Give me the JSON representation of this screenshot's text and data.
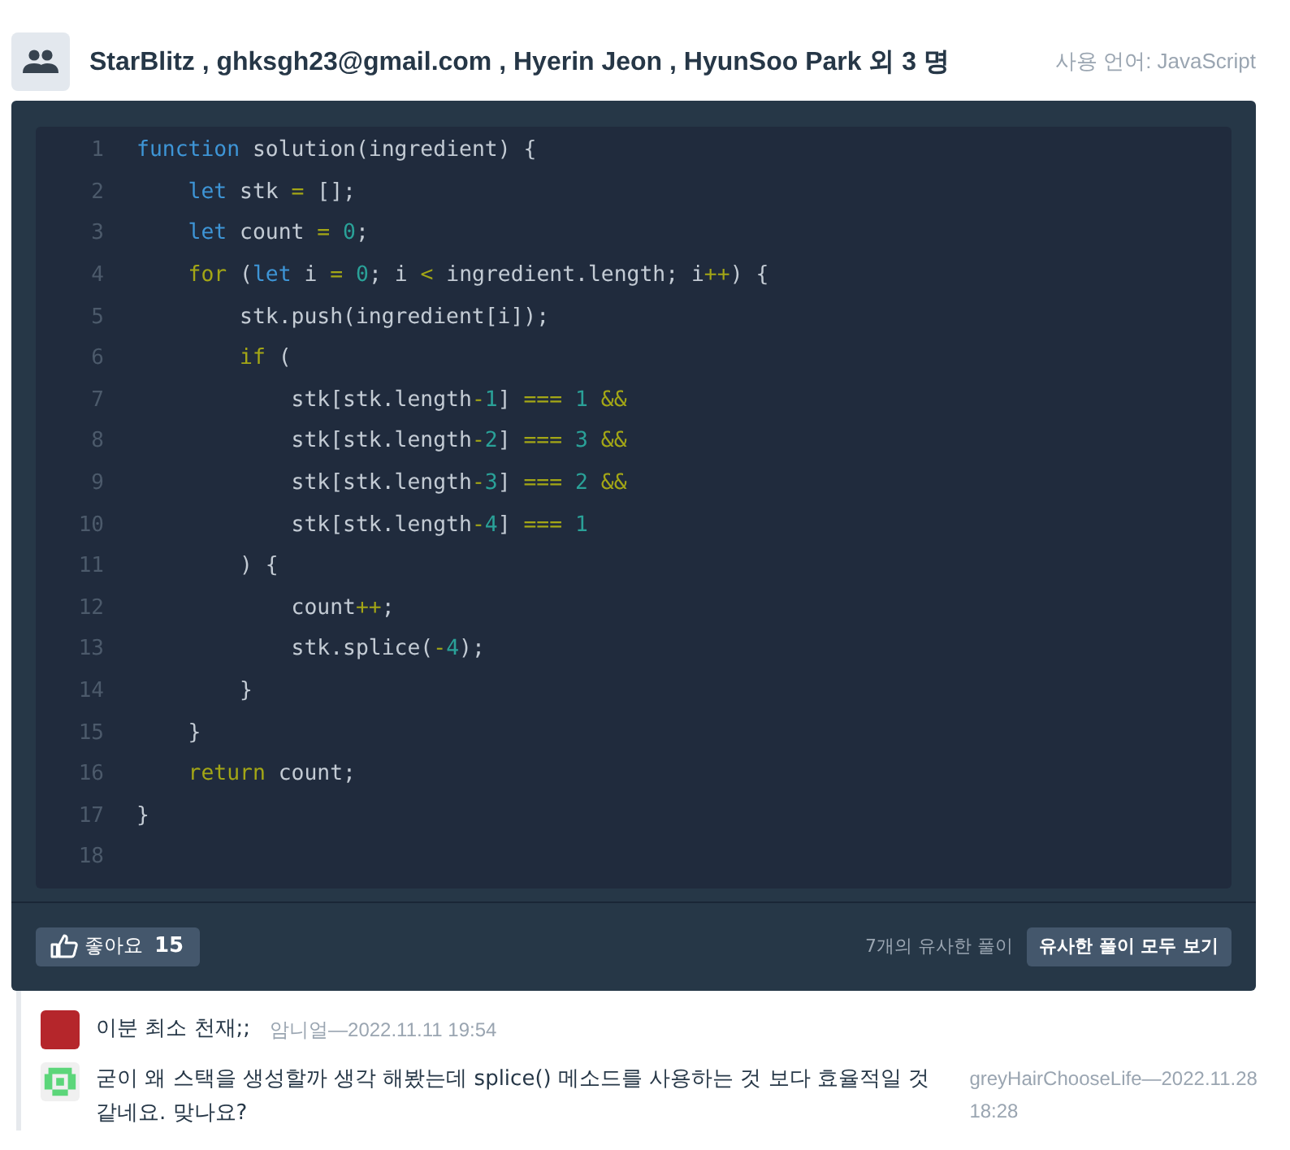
{
  "header": {
    "authors": "StarBlitz , ghksgh23@gmail.com , Hyerin Jeon , HyunSoo Park 외 3 명",
    "language": "사용 언어: JavaScript"
  },
  "code": {
    "lines": [
      {
        "number": "1",
        "tokens": [
          {
            "t": "function",
            "color": "#3e95d6"
          },
          {
            "t": " solution(ingredient) {",
            "color": "#c3cbd4"
          }
        ]
      },
      {
        "number": "2",
        "tokens": [
          {
            "t": "    let",
            "color": "#3e95d6"
          },
          {
            "t": " stk ",
            "color": "#c3cbd4"
          },
          {
            "t": "=",
            "color": "#a3a616"
          },
          {
            "t": " [];",
            "color": "#c3cbd4"
          }
        ]
      },
      {
        "number": "3",
        "tokens": [
          {
            "t": "    let",
            "color": "#3e95d6"
          },
          {
            "t": " count ",
            "color": "#c3cbd4"
          },
          {
            "t": "=",
            "color": "#a3a616"
          },
          {
            "t": " 0",
            "color": "#2aa198"
          },
          {
            "t": ";",
            "color": "#c3cbd4"
          }
        ]
      },
      {
        "number": "4",
        "tokens": [
          {
            "t": "    for",
            "color": "#a3a616"
          },
          {
            "t": " (",
            "color": "#c3cbd4"
          },
          {
            "t": "let",
            "color": "#3e95d6"
          },
          {
            "t": " i ",
            "color": "#c3cbd4"
          },
          {
            "t": "=",
            "color": "#a3a616"
          },
          {
            "t": " 0",
            "color": "#2aa198"
          },
          {
            "t": "; i ",
            "color": "#c3cbd4"
          },
          {
            "t": "<",
            "color": "#a3a616"
          },
          {
            "t": " ingredient.length; i",
            "color": "#c3cbd4"
          },
          {
            "t": "++",
            "color": "#a3a616"
          },
          {
            "t": ") {",
            "color": "#c3cbd4"
          }
        ]
      },
      {
        "number": "5",
        "tokens": [
          {
            "t": "        stk.push(ingredient[i]);",
            "color": "#c3cbd4"
          }
        ]
      },
      {
        "number": "6",
        "tokens": [
          {
            "t": "        if",
            "color": "#a3a616"
          },
          {
            "t": " (",
            "color": "#c3cbd4"
          }
        ]
      },
      {
        "number": "7",
        "tokens": [
          {
            "t": "            stk[stk.length",
            "color": "#c3cbd4"
          },
          {
            "t": "-",
            "color": "#a3a616"
          },
          {
            "t": "1",
            "color": "#2aa198"
          },
          {
            "t": "] ",
            "color": "#c3cbd4"
          },
          {
            "t": "===",
            "color": "#a3a616"
          },
          {
            "t": " 1",
            "color": "#2aa198"
          },
          {
            "t": " &&",
            "color": "#a3a616"
          }
        ]
      },
      {
        "number": "8",
        "tokens": [
          {
            "t": "            stk[stk.length",
            "color": "#c3cbd4"
          },
          {
            "t": "-",
            "color": "#a3a616"
          },
          {
            "t": "2",
            "color": "#2aa198"
          },
          {
            "t": "] ",
            "color": "#c3cbd4"
          },
          {
            "t": "===",
            "color": "#a3a616"
          },
          {
            "t": " 3",
            "color": "#2aa198"
          },
          {
            "t": " &&",
            "color": "#a3a616"
          }
        ]
      },
      {
        "number": "9",
        "tokens": [
          {
            "t": "            stk[stk.length",
            "color": "#c3cbd4"
          },
          {
            "t": "-",
            "color": "#a3a616"
          },
          {
            "t": "3",
            "color": "#2aa198"
          },
          {
            "t": "] ",
            "color": "#c3cbd4"
          },
          {
            "t": "===",
            "color": "#a3a616"
          },
          {
            "t": " 2",
            "color": "#2aa198"
          },
          {
            "t": " &&",
            "color": "#a3a616"
          }
        ]
      },
      {
        "number": "10",
        "tokens": [
          {
            "t": "            stk[stk.length",
            "color": "#c3cbd4"
          },
          {
            "t": "-",
            "color": "#a3a616"
          },
          {
            "t": "4",
            "color": "#2aa198"
          },
          {
            "t": "] ",
            "color": "#c3cbd4"
          },
          {
            "t": "===",
            "color": "#a3a616"
          },
          {
            "t": " 1",
            "color": "#2aa198"
          }
        ]
      },
      {
        "number": "11",
        "tokens": [
          {
            "t": "        ) {",
            "color": "#c3cbd4"
          }
        ]
      },
      {
        "number": "12",
        "tokens": [
          {
            "t": "            count",
            "color": "#c3cbd4"
          },
          {
            "t": "++",
            "color": "#a3a616"
          },
          {
            "t": ";",
            "color": "#c3cbd4"
          }
        ]
      },
      {
        "number": "13",
        "tokens": [
          {
            "t": "            stk.splice(",
            "color": "#c3cbd4"
          },
          {
            "t": "-",
            "color": "#a3a616"
          },
          {
            "t": "4",
            "color": "#2aa198"
          },
          {
            "t": ");",
            "color": "#c3cbd4"
          }
        ]
      },
      {
        "number": "14",
        "tokens": [
          {
            "t": "        }",
            "color": "#c3cbd4"
          }
        ]
      },
      {
        "number": "15",
        "tokens": [
          {
            "t": "    }",
            "color": "#c3cbd4"
          }
        ]
      },
      {
        "number": "16",
        "tokens": [
          {
            "t": "    return",
            "color": "#a3a616"
          },
          {
            "t": " count;",
            "color": "#c3cbd4"
          }
        ]
      },
      {
        "number": "17",
        "tokens": [
          {
            "t": "}",
            "color": "#c3cbd4"
          }
        ]
      },
      {
        "number": "18"
      }
    ]
  },
  "footer": {
    "like_label": "좋아요",
    "like_count": "15",
    "similar_count": "7개의 유사한 풀이",
    "similar_button": "유사한 풀이 모두 보기"
  },
  "comments": [
    {
      "kind": "photo",
      "text": "이분 최소 천재;;",
      "meta": "암니얼—2022.11.11 19:54"
    },
    {
      "kind": "identicon",
      "text": "굳이 왜 스택을 생성할까 생각 해봤는데 splice() 메소드를 사용하는 것 보다 효율적일 것 같네요. 맞나요?",
      "meta": "greyHairChooseLife—2022.11.28 18:28"
    }
  ]
}
